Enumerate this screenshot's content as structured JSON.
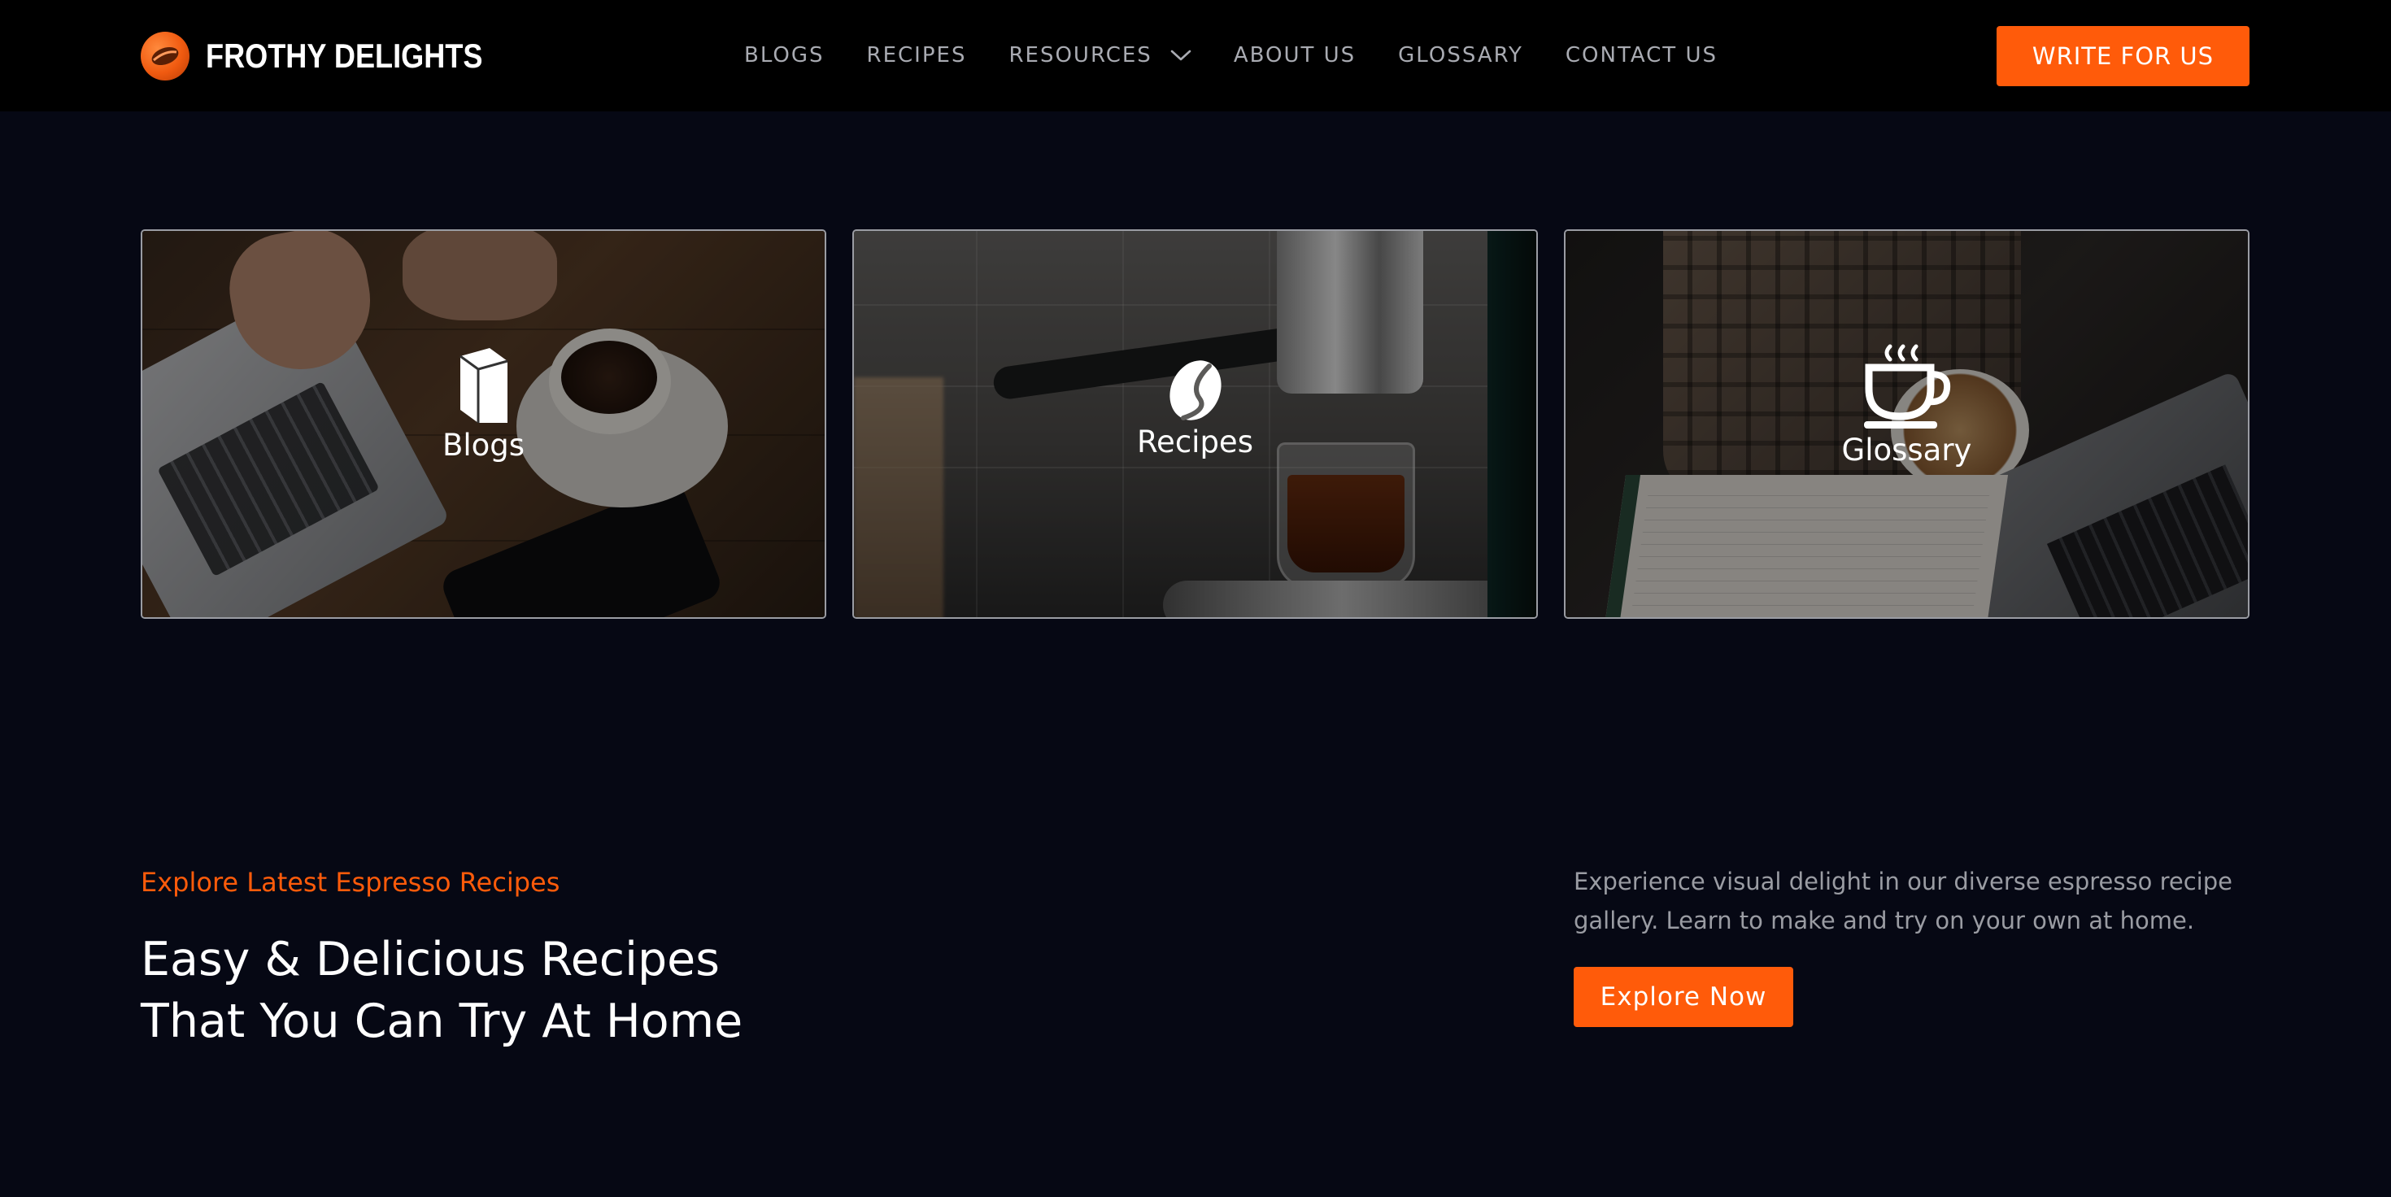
{
  "header": {
    "brand": "FROTHY DELIGHTS",
    "logo_icon": "coffee-bean-icon",
    "nav": [
      {
        "label": "BLOGS"
      },
      {
        "label": "RECIPES"
      },
      {
        "label": "RESOURCES",
        "has_dropdown": true
      },
      {
        "label": "ABOUT US"
      },
      {
        "label": "GLOSSARY"
      },
      {
        "label": "CONTACT US"
      }
    ],
    "cta_label": "WRITE FOR US"
  },
  "cards": [
    {
      "label": "Blogs",
      "icon": "book-icon"
    },
    {
      "label": "Recipes",
      "icon": "coffee-bean-icon"
    },
    {
      "label": "Glossary",
      "icon": "coffee-cup-icon"
    }
  ],
  "section": {
    "eyebrow": "Explore Latest Espresso Recipes",
    "headline_line1": "Easy & Delicious Recipes",
    "headline_line2": "That You Can Try At Home",
    "description": "Experience visual delight in our diverse espresso recipe gallery. Learn to make and try on your own at home.",
    "button_label": "Explore Now"
  },
  "colors": {
    "accent": "#ff5b0a",
    "page_background": "#060814",
    "header_background": "#000000",
    "nav_text": "#a9abb2"
  }
}
